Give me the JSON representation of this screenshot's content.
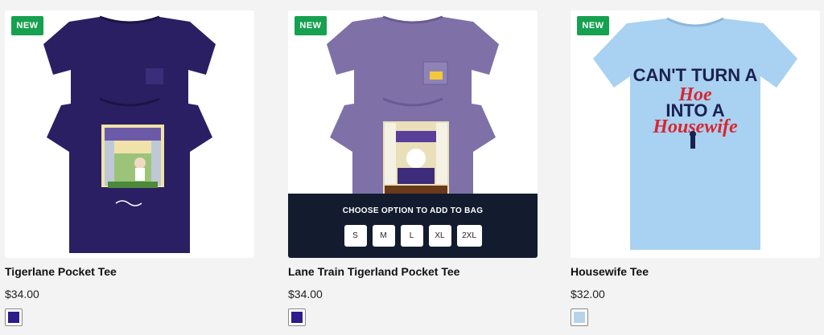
{
  "products": [
    {
      "badge": "NEW",
      "title": "Tigerlane Pocket Tee",
      "price": "$34.00",
      "swatch_color": "#2c1d8a",
      "shirt_color": "#2a1f63",
      "artwork": "Tiger lane scene with golfer"
    },
    {
      "badge": "NEW",
      "title": "Lane Train Tigerland Pocket Tee",
      "price": "$34.00",
      "swatch_color": "#2c1d8a",
      "shirt_color": "#7f71a8",
      "overlay": {
        "label": "CHOOSE OPTION TO ADD TO BAG",
        "sizes": [
          "S",
          "M",
          "L",
          "XL",
          "2XL"
        ]
      }
    },
    {
      "badge": "NEW",
      "title": "Housewife Tee",
      "price": "$32.00",
      "swatch_color": "#b7d3e9",
      "shirt_color": "#a9d1f1",
      "print": {
        "line1": "CAN'T TURN A",
        "line2": "Hoe",
        "line3": "INTO A",
        "line4": "Housewife"
      }
    }
  ]
}
